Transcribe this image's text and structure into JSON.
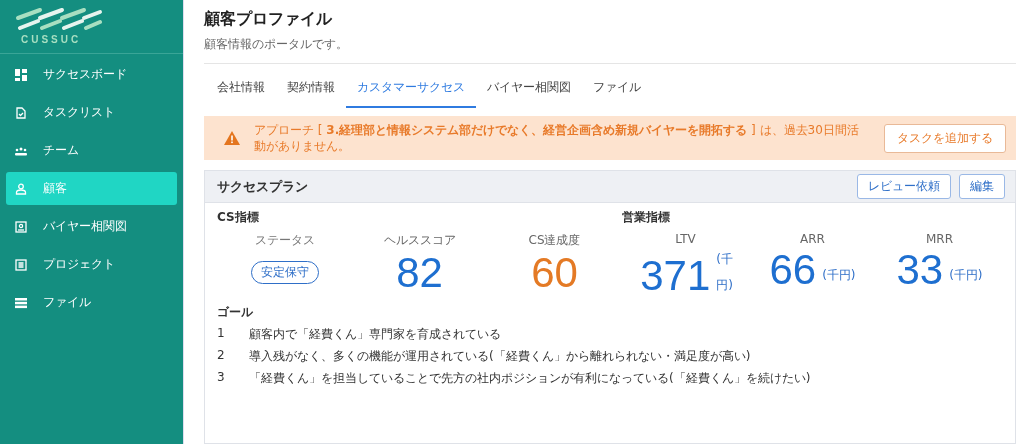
{
  "logo": {
    "text": "CUSSUC"
  },
  "sidebar": {
    "items": [
      {
        "label": "サクセスボード",
        "selected": false
      },
      {
        "label": "タスクリスト",
        "selected": false
      },
      {
        "label": "チーム",
        "selected": false
      },
      {
        "label": "顧客",
        "selected": true
      },
      {
        "label": "バイヤー相関図",
        "selected": false
      },
      {
        "label": "プロジェクト",
        "selected": false
      },
      {
        "label": "ファイル",
        "selected": false
      }
    ]
  },
  "page": {
    "title": "顧客プロファイル",
    "subtitle": "顧客情報のポータルです。"
  },
  "tabs": [
    {
      "label": "会社情報",
      "selected": false
    },
    {
      "label": "契約情報",
      "selected": false
    },
    {
      "label": "カスタマーサクセス",
      "selected": true
    },
    {
      "label": "バイヤー相関図",
      "selected": false
    },
    {
      "label": "ファイル",
      "selected": false
    }
  ],
  "alert": {
    "text": "アプローチ [ **3.経理部と情報システム部だけでなく、経営企画含め新規バイヤーを開拓する** ] は、過去30日間活動がありません。",
    "button": "タスクを追加する"
  },
  "plan": {
    "title": "サクセスプラン",
    "buttons": [
      "レビュー依頼",
      "編集"
    ],
    "cs_heading": "CS指標",
    "sales_heading": "営業指標",
    "cs_metrics": [
      {
        "kind": "badge",
        "label": "ステータス",
        "value": "安定保守"
      },
      {
        "kind": "number",
        "label": "ヘルススコア",
        "value": "82",
        "color": "#1e6fd0"
      },
      {
        "kind": "number",
        "label": "CS達成度",
        "value": "60",
        "color": "#e47a25"
      }
    ],
    "sales_metrics": [
      {
        "label": "LTV",
        "value": "371",
        "unit": "(千円)",
        "wrap": true
      },
      {
        "label": "ARR",
        "value": "66",
        "unit": "(千円)",
        "wrap": false
      },
      {
        "label": "MRR",
        "value": "33",
        "unit": "(千円)",
        "wrap": false
      }
    ],
    "goals_heading": "ゴール",
    "goals": [
      {
        "number": "1",
        "text": "顧客内で「経費くん」専門家を育成されている"
      },
      {
        "number": "2",
        "text": "導入残がなく、多くの機能が運用されている(「経費くん」から離れられない・満足度が高い)"
      },
      {
        "number": "3",
        "text": "「経費くん」を担当していることで先方の社内ポジションが有利になっている(「経費くん」を続けたい)"
      }
    ]
  }
}
